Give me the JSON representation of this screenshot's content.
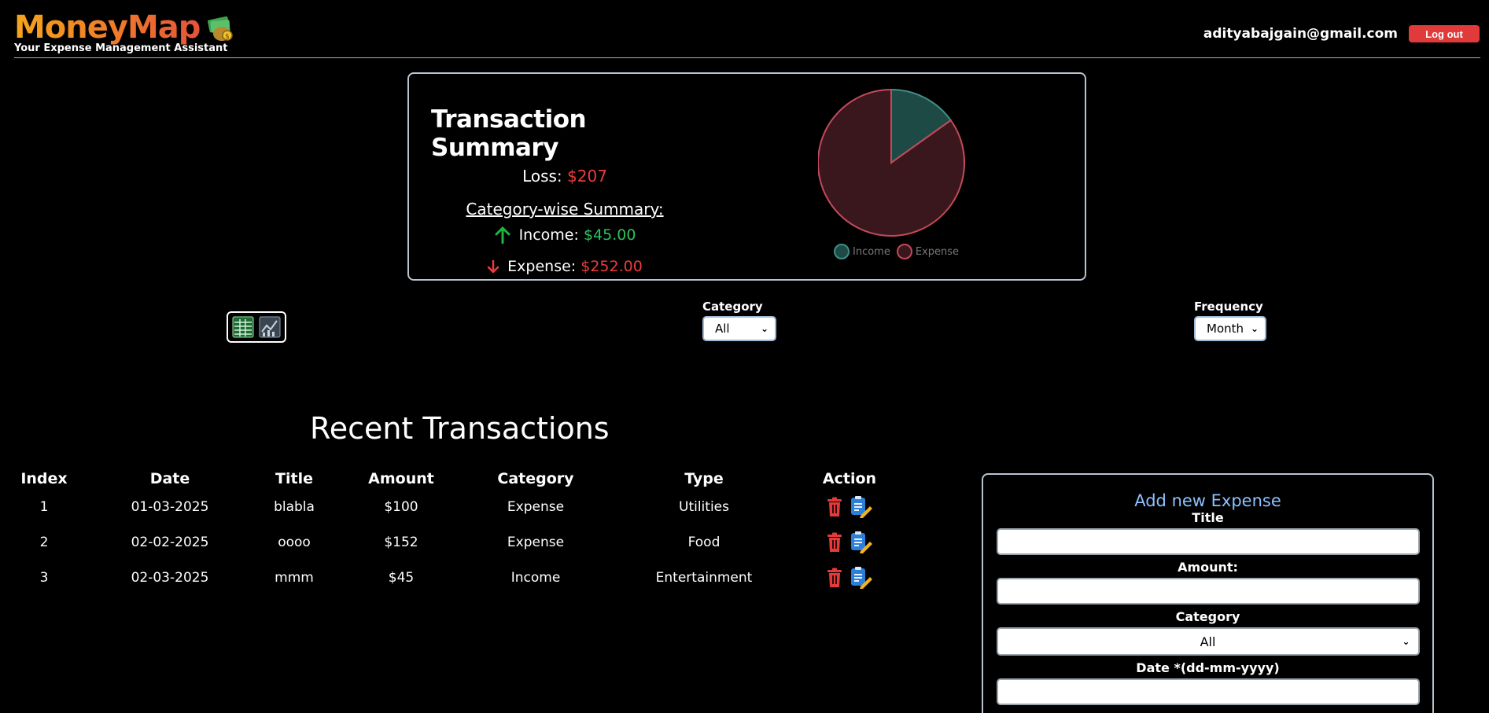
{
  "header": {
    "app_title": "MoneyMap",
    "tagline": "Your Expense Management Assistant",
    "user_email": "adityabajgain@gmail.com",
    "logout_label": "Log out"
  },
  "summary": {
    "title": "Transaction Summary",
    "loss_label": "Loss:",
    "loss_value": "$207",
    "category_heading": "Category-wise Summary:",
    "income_label": "Income:",
    "income_value": "$45.00",
    "expense_label": "Expense:",
    "expense_value": "$252.00"
  },
  "chart_data": {
    "type": "pie",
    "labels": [
      "Income",
      "Expense"
    ],
    "values": [
      45,
      252
    ],
    "colors": [
      "#1e4a46",
      "#3a171c"
    ],
    "border_colors": [
      "#3f8f86",
      "#c44a5a"
    ],
    "legend_position": "bottom"
  },
  "filters": {
    "category_label": "Category",
    "category_value": "All",
    "frequency_label": "Frequency",
    "frequency_value": "Month"
  },
  "transactions": {
    "title": "Recent Transactions",
    "columns": [
      "Index",
      "Date",
      "Title",
      "Amount",
      "Category",
      "Type",
      "Action"
    ],
    "rows": [
      {
        "index": "1",
        "date": "01-03-2025",
        "title": "blabla",
        "amount": "$100",
        "category": "Expense",
        "type": "Utilities"
      },
      {
        "index": "2",
        "date": "02-02-2025",
        "title": "oooo",
        "amount": "$152",
        "category": "Expense",
        "type": "Food"
      },
      {
        "index": "3",
        "date": "02-03-2025",
        "title": "mmm",
        "amount": "$45",
        "category": "Income",
        "type": "Entertainment"
      }
    ]
  },
  "add_form": {
    "title": "Add new Expense",
    "title_label": "Title",
    "amount_label": "Amount:",
    "category_label": "Category",
    "category_value": "All",
    "date_label": "Date *(dd-mm-yyyy)"
  },
  "colors": {
    "accent_red": "#ee3b3b",
    "accent_green": "#2ec25b",
    "form_title": "#8cc1ff"
  }
}
